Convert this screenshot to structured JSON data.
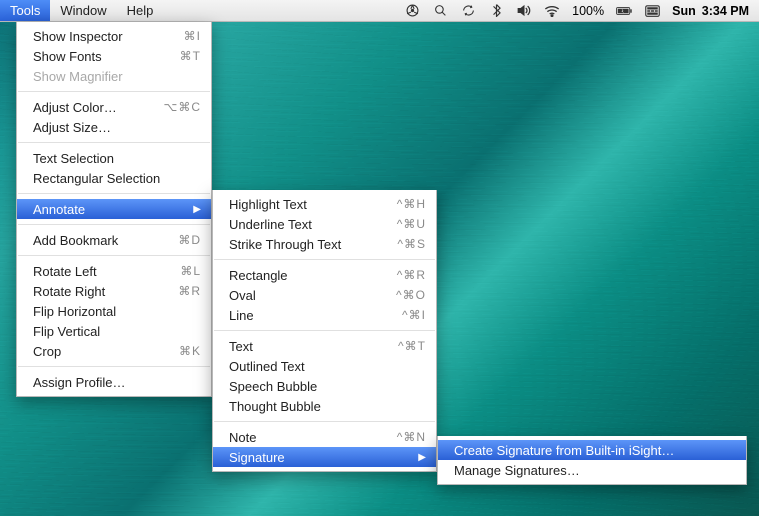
{
  "menubar": {
    "items": [
      "Tools",
      "Window",
      "Help"
    ],
    "battery": "100%",
    "clock_day": "Sun",
    "clock_time": "3:34 PM"
  },
  "tools_menu": {
    "g1": [
      {
        "label": "Show Inspector",
        "shortcut": "⌘I"
      },
      {
        "label": "Show Fonts",
        "shortcut": "⌘T"
      },
      {
        "label": "Show Magnifier",
        "shortcut": "",
        "disabled": true
      }
    ],
    "g2": [
      {
        "label": "Adjust Color…",
        "shortcut": "⌥⌘C"
      },
      {
        "label": "Adjust Size…",
        "shortcut": ""
      }
    ],
    "g3": [
      {
        "label": "Text Selection",
        "shortcut": ""
      },
      {
        "label": "Rectangular Selection",
        "shortcut": ""
      }
    ],
    "annotate_label": "Annotate",
    "g4": [
      {
        "label": "Add Bookmark",
        "shortcut": "⌘D"
      }
    ],
    "g5": [
      {
        "label": "Rotate Left",
        "shortcut": "⌘L"
      },
      {
        "label": "Rotate Right",
        "shortcut": "⌘R"
      },
      {
        "label": "Flip Horizontal",
        "shortcut": ""
      },
      {
        "label": "Flip Vertical",
        "shortcut": ""
      },
      {
        "label": "Crop",
        "shortcut": "⌘K"
      }
    ],
    "g6": [
      {
        "label": "Assign Profile…",
        "shortcut": ""
      }
    ]
  },
  "annotate_menu": {
    "g1": [
      {
        "label": "Highlight Text",
        "shortcut": "^⌘H"
      },
      {
        "label": "Underline Text",
        "shortcut": "^⌘U"
      },
      {
        "label": "Strike Through Text",
        "shortcut": "^⌘S"
      }
    ],
    "g2": [
      {
        "label": "Rectangle",
        "shortcut": "^⌘R"
      },
      {
        "label": "Oval",
        "shortcut": "^⌘O"
      },
      {
        "label": "Line",
        "shortcut": "^⌘I"
      }
    ],
    "g3": [
      {
        "label": "Text",
        "shortcut": "^⌘T"
      },
      {
        "label": "Outlined Text",
        "shortcut": ""
      },
      {
        "label": "Speech Bubble",
        "shortcut": ""
      },
      {
        "label": "Thought Bubble",
        "shortcut": ""
      }
    ],
    "g4": [
      {
        "label": "Note",
        "shortcut": "^⌘N"
      }
    ],
    "signature_label": "Signature"
  },
  "signature_menu": {
    "create": "Create Signature from Built-in iSight…",
    "manage": "Manage Signatures…"
  }
}
